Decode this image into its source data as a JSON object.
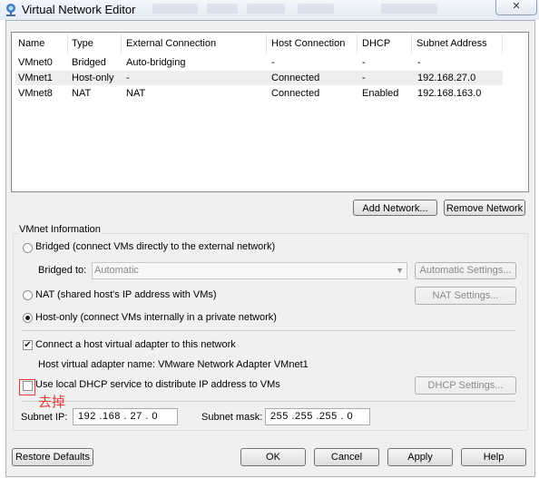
{
  "window": {
    "title": "Virtual Network Editor",
    "close_label": "✕"
  },
  "table": {
    "headers": [
      "Name",
      "Type",
      "External Connection",
      "Host Connection",
      "DHCP",
      "Subnet Address"
    ],
    "rows": [
      [
        "VMnet0",
        "Bridged",
        "Auto-bridging",
        "-",
        "-",
        "-"
      ],
      [
        "VMnet1",
        "Host-only",
        "-",
        "Connected",
        "-",
        "192.168.27.0"
      ],
      [
        "VMnet8",
        "NAT",
        "NAT",
        "Connected",
        "Enabled",
        "192.168.163.0"
      ]
    ],
    "selected_row": 1
  },
  "buttons": {
    "add_network": "Add Network...",
    "remove_network": "Remove Network",
    "automatic_settings": "Automatic Settings...",
    "nat_settings": "NAT Settings...",
    "dhcp_settings": "DHCP Settings...",
    "restore_defaults": "Restore Defaults",
    "ok": "OK",
    "cancel": "Cancel",
    "apply": "Apply",
    "help": "Help"
  },
  "vmnet_info": {
    "group_label": "VMnet Information",
    "bridged_label": "Bridged (connect VMs directly to the external network)",
    "bridged_to_label": "Bridged to:",
    "bridged_to_value": "Automatic",
    "nat_label": "NAT (shared host's IP address with VMs)",
    "hostonly_label": "Host-only (connect VMs internally in a private network)",
    "selected_mode": "host-only",
    "connect_adapter_label": "Connect a host virtual adapter to this network",
    "connect_adapter_checked": true,
    "adapter_name_text": "Host virtual adapter name: VMware Network Adapter VMnet1",
    "dhcp_label": "Use local DHCP service to distribute IP address to VMs",
    "dhcp_checked": false,
    "subnet_ip_label": "Subnet IP:",
    "subnet_ip_value": "192 .168 . 27 . 0",
    "subnet_mask_label": "Subnet mask:",
    "subnet_mask_value": "255 .255 .255 . 0"
  },
  "annotation": {
    "text": "去掉",
    "color": "#e03a3a"
  }
}
